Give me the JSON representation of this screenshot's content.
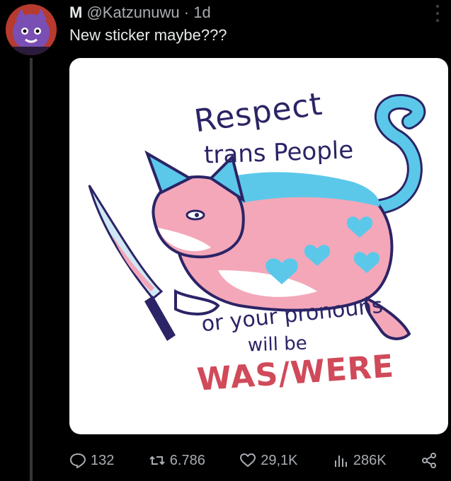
{
  "post": {
    "display_name": "M",
    "handle": "@Katzunuwu",
    "separator": "·",
    "time_ago": "1d",
    "text": "New sticker maybe???"
  },
  "sticker": {
    "line1": "Respect",
    "line2": "trans People",
    "line3": "or your pronouns",
    "line4": "will be",
    "line5": "WAS/WERE"
  },
  "actions": {
    "replies": "132",
    "reposts": "6.786",
    "likes": "29,1K",
    "views": "286K"
  },
  "icons": {
    "more": "more-vertical-icon",
    "reply": "reply-icon",
    "repost": "repost-icon",
    "like": "heart-icon",
    "views": "views-icon",
    "share": "share-icon"
  },
  "colors": {
    "background": "#000000",
    "text_primary": "#e7e9ea",
    "text_secondary": "#a8adb2",
    "trans_blue": "#5bc8ea",
    "trans_pink": "#f4a7b9",
    "sticker_red": "#d04a5a",
    "ink": "#2b2466"
  }
}
